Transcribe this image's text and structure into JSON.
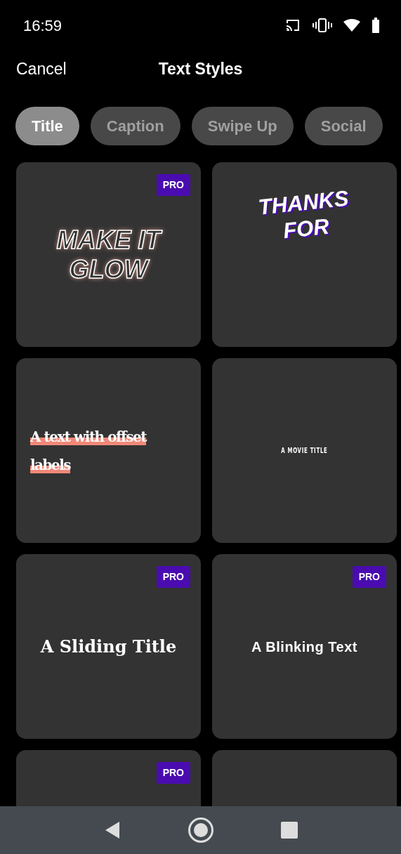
{
  "status_bar": {
    "time": "16:59"
  },
  "header": {
    "cancel": "Cancel",
    "title": "Text Styles"
  },
  "tabs": [
    {
      "label": "Title",
      "selected": true
    },
    {
      "label": "Caption",
      "selected": false
    },
    {
      "label": "Swipe Up",
      "selected": false
    },
    {
      "label": "Social",
      "selected": false
    }
  ],
  "cards": [
    {
      "kind": "glow",
      "text": "MAKE IT GLOW",
      "badge": "PRO"
    },
    {
      "kind": "slanted",
      "text": "THANKS FOR"
    },
    {
      "kind": "offset",
      "text": "A text with offset labels"
    },
    {
      "kind": "movie",
      "text": "A MOVIE TITLE"
    },
    {
      "kind": "serif",
      "text": "A Sliding Title",
      "badge": "PRO"
    },
    {
      "kind": "blink",
      "text": "A Blinking Text",
      "badge": "PRO"
    },
    {
      "kind": "blank",
      "badge": "PRO"
    },
    {
      "kind": "blank"
    }
  ]
}
